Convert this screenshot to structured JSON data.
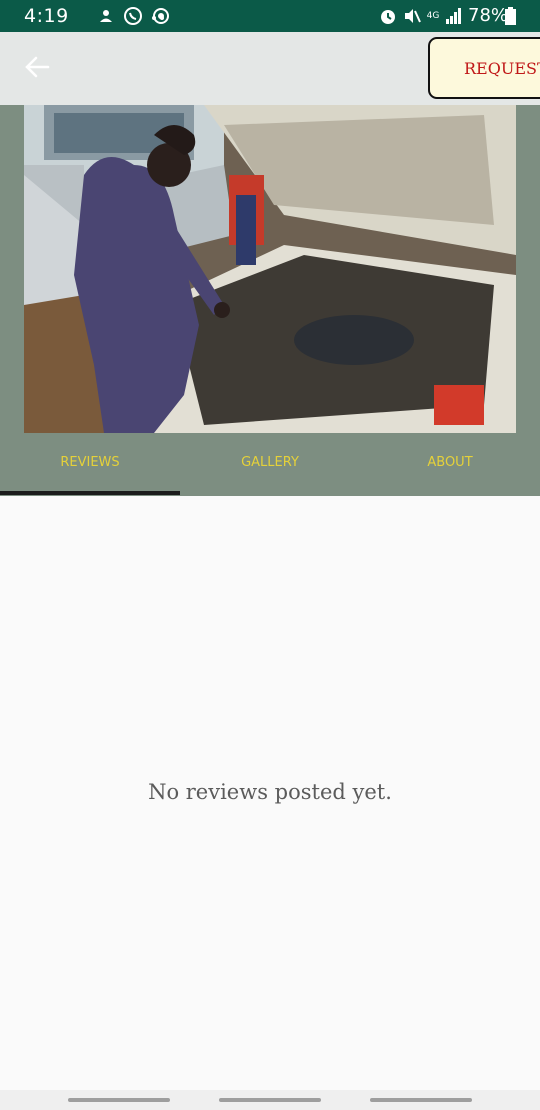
{
  "status_bar": {
    "time": "4:19",
    "network_label": "4G",
    "battery": "78%",
    "icons": [
      "dnd-icon",
      "whatsapp-icon",
      "hotspot-icon",
      "more-dots-icon",
      "alarm-icon",
      "mute-icon",
      "network-4g-icon",
      "signal-icon",
      "battery-icon"
    ]
  },
  "app_bar": {
    "back_icon": "arrow-left-icon",
    "request_label": "REQUEST"
  },
  "tabs": [
    {
      "label": "REVIEWS",
      "selected": true
    },
    {
      "label": "GALLERY",
      "selected": false
    },
    {
      "label": "ABOUT",
      "selected": false
    }
  ],
  "reviews": {
    "empty_message": "No reviews posted yet."
  },
  "colors": {
    "status_bar": "#0b5a48",
    "app_bar": "#e4e7e6",
    "header_panel": "#7d8e81",
    "tab_text": "#e5d13a",
    "tab_indicator": "#1c1c1c",
    "request_text": "#c01818",
    "request_bg": "#fdf9dc"
  }
}
